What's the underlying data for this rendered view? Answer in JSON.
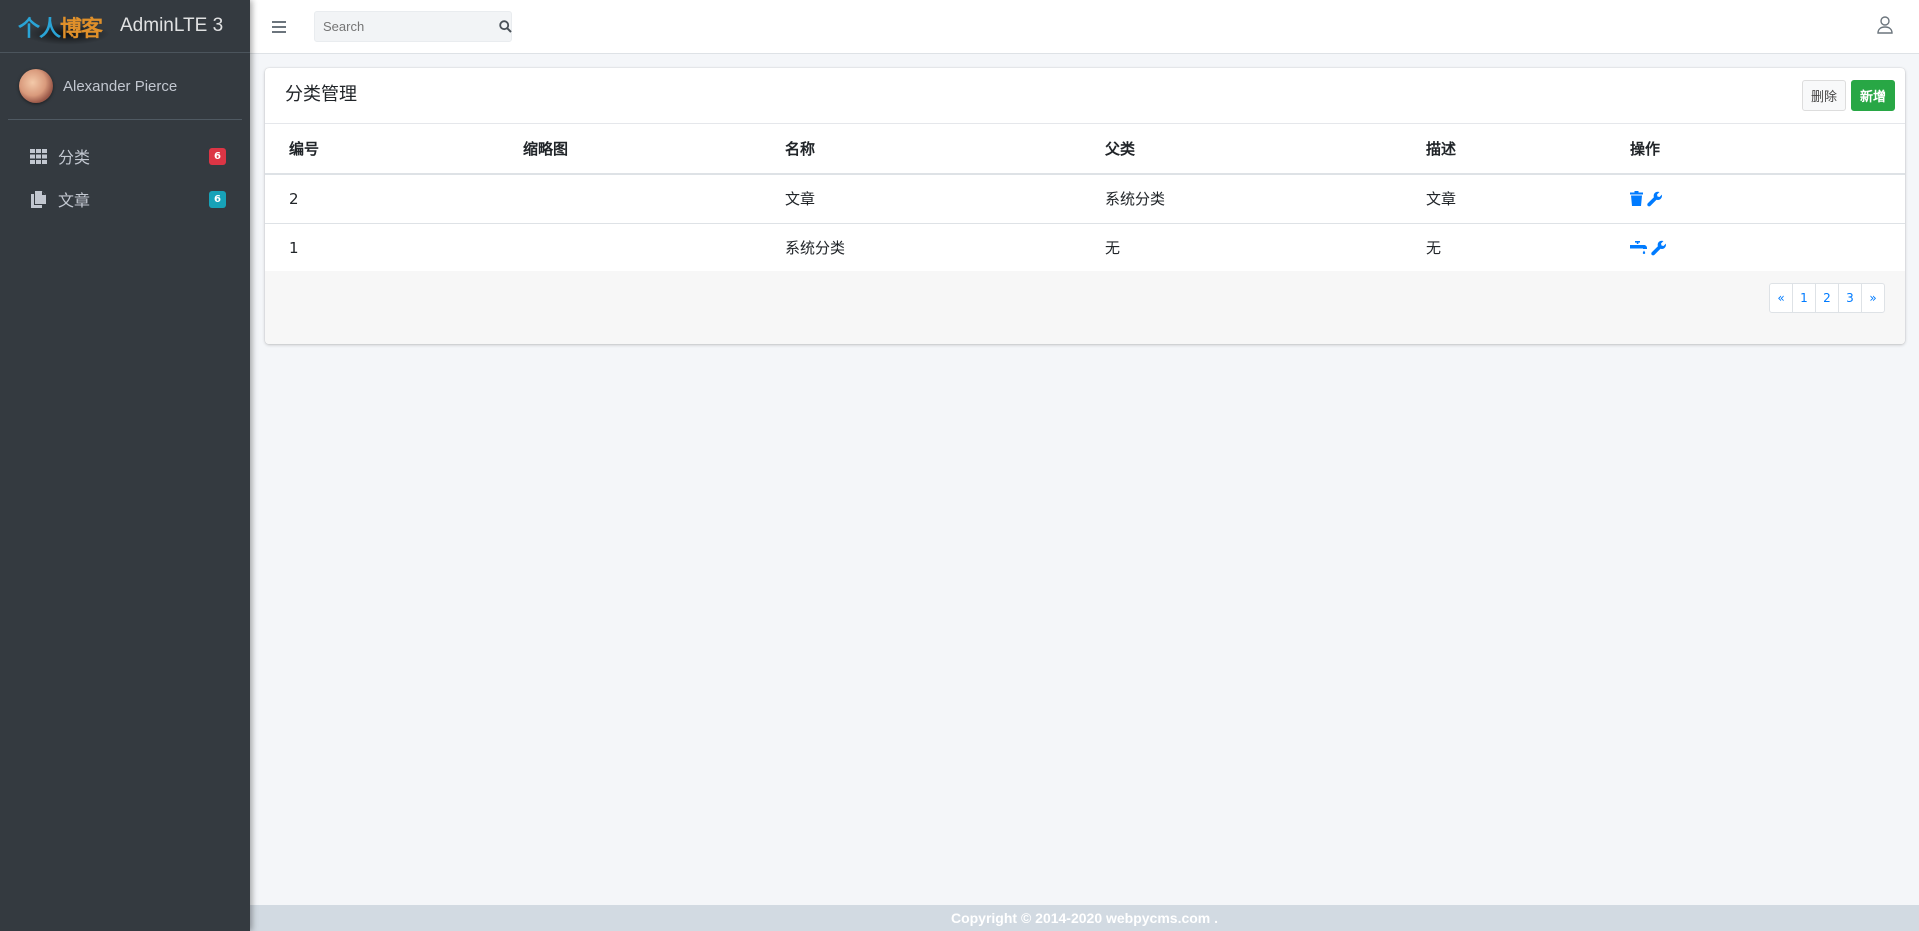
{
  "brand": {
    "logo_part1": "个人",
    "logo_part2": "博客",
    "title": "AdminLTE 3"
  },
  "user": {
    "name": "Alexander Pierce"
  },
  "sidebar": {
    "items": [
      {
        "label": "分类",
        "badge": "6",
        "icon": "grid-icon",
        "badge_color": "#dc3545"
      },
      {
        "label": "文章",
        "badge": "6",
        "icon": "copy-icon",
        "badge_color": "#17a2b8"
      }
    ]
  },
  "navbar": {
    "search_placeholder": "Search"
  },
  "card": {
    "title": "分类管理",
    "delete_label": "删除",
    "add_label": "新增",
    "columns": [
      "编号",
      "缩略图",
      "名称",
      "父类",
      "描述",
      "操作"
    ],
    "rows": [
      {
        "id": "2",
        "thumb": "",
        "name": "文章",
        "parent": "系统分类",
        "desc": "文章",
        "op_icon": "trash-icon"
      },
      {
        "id": "1",
        "thumb": "",
        "name": "系统分类",
        "parent": "无",
        "desc": "无",
        "op_icon": "faucet-icon"
      }
    ],
    "pagination": [
      "«",
      "1",
      "2",
      "3",
      "»"
    ]
  },
  "footer": {
    "text": "Copyright © 2014-2020 webpycms.com ."
  },
  "colors": {
    "sidebar_bg": "#343a40",
    "primary": "#007bff",
    "success": "#28a745",
    "danger": "#dc3545",
    "info": "#17a2b8"
  }
}
